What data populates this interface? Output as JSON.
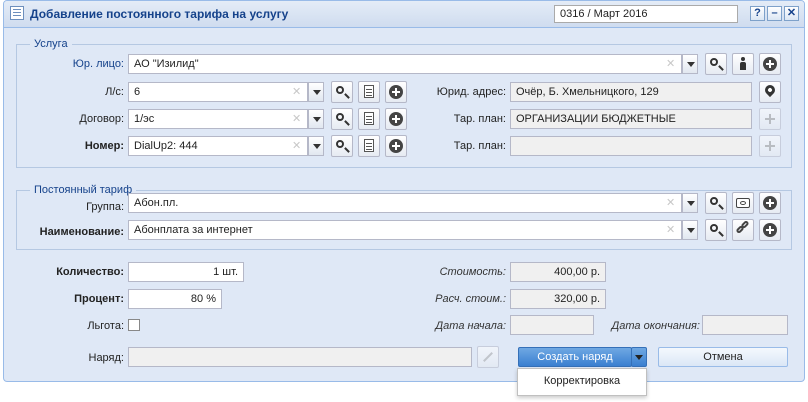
{
  "window": {
    "title": "Добавление постоянного тарифа на услугу",
    "period": "0316 / Март 2016",
    "buttons": [
      "?",
      "–",
      "✕"
    ]
  },
  "service_section": {
    "legend": "Услуга",
    "legal_entity": {
      "label": "Юр. лицо:",
      "value": "АО \"Изилид\""
    },
    "account": {
      "label": "Л/с:",
      "value": "6"
    },
    "contract": {
      "label": "Договор:",
      "value": "1/эс"
    },
    "number": {
      "label": "Номер:",
      "value": "DialUp2: 444"
    },
    "legal_address": {
      "label": "Юрид. адрес:",
      "value": "Очёр, Б. Хмельницкого, 129"
    },
    "tariff_plan": {
      "label": "Тар. план:",
      "value": "ОРГАНИЗАЦИИ БЮДЖЕТНЫЕ"
    },
    "tariff_plan2": {
      "label": "Тар. план:",
      "value": ""
    }
  },
  "tariff_section": {
    "legend": "Постоянный тариф",
    "group": {
      "label": "Группа:",
      "value": "Абон.пл."
    },
    "name": {
      "label": "Наименование:",
      "value": "Абонплата за интернет"
    }
  },
  "bottom": {
    "quantity": {
      "label": "Количество:",
      "value": "1 шт."
    },
    "percent": {
      "label": "Процент:",
      "value": "80 %"
    },
    "benefit": {
      "label": "Льгота:"
    },
    "order": {
      "label": "Наряд:",
      "value": ""
    },
    "cost": {
      "label": "Стоимость:",
      "value": "400,00 р."
    },
    "calc_cost": {
      "label": "Расч. стоим.:",
      "value": "320,00 р."
    },
    "start_date": {
      "label": "Дата начала:",
      "value": ""
    },
    "end_date": {
      "label": "Дата окончания:",
      "value": ""
    }
  },
  "actions": {
    "create_order": "Создать наряд",
    "cancel": "Отмена",
    "menu_item": "Корректировка"
  },
  "icons": [
    "window-icon",
    "search-icon",
    "person-icon",
    "plus-icon",
    "document-icon",
    "map-pin-icon",
    "network-icon",
    "card-icon",
    "link-icon",
    "wrench-icon"
  ]
}
